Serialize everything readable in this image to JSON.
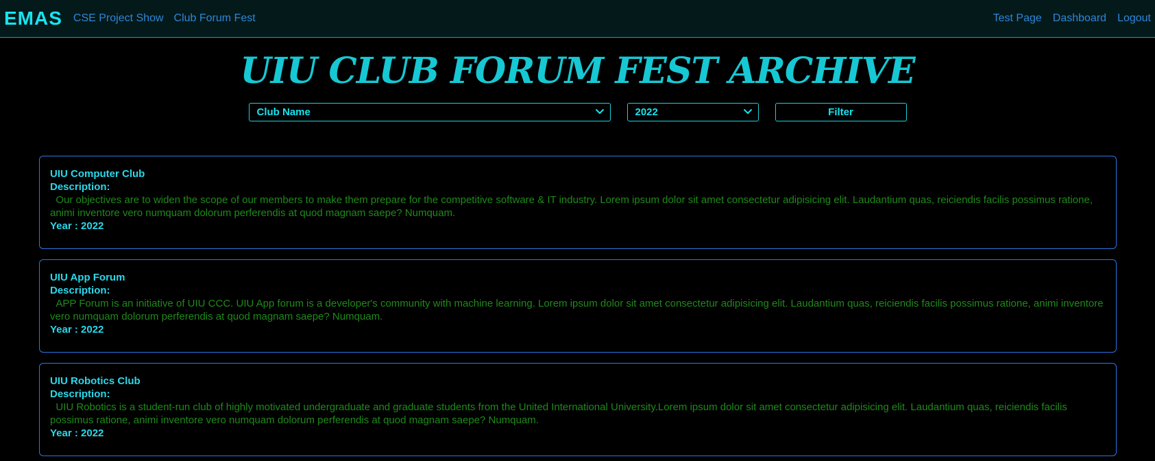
{
  "navbar": {
    "brand": "EMAS",
    "left_links": [
      "CSE Project Show",
      "Club Forum Fest"
    ],
    "right_links": [
      "Test Page",
      "Dashboard",
      "Logout"
    ]
  },
  "page_title": "UIU CLUB FORUM FEST ARCHIVE",
  "filters": {
    "club_select_value": "Club Name",
    "year_select_value": "2022",
    "filter_button_label": "Filter"
  },
  "description_label": "Description:",
  "clubs": [
    {
      "name": "UIU Computer Club",
      "description": "  Our objectives are to widen the scope of our members to make them prepare for the competitive software & IT industry. Lorem ipsum dolor sit amet consectetur adipisicing elit. Laudantium quas, reiciendis facilis possimus ratione, animi inventore vero numquam dolorum perferendis at quod magnam saepe? Numquam.",
      "year": "Year : 2022"
    },
    {
      "name": "UIU App Forum",
      "description": "  APP Forum is an initiative of UIU CCC. UIU App forum is a developer's community with machine learning. Lorem ipsum dolor sit amet consectetur adipisicing elit. Laudantium quas, reiciendis facilis possimus ratione, animi inventore vero numquam dolorum perferendis at quod magnam saepe? Numquam.",
      "year": "Year : 2022"
    },
    {
      "name": "UIU Robotics Club",
      "description": "  UIU Robotics is a student-run club of highly motivated undergraduate and graduate students from the United International University.Lorem ipsum dolor sit amet consectetur adipisicing elit. Laudantium quas, reiciendis facilis possimus ratione, animi inventore vero numquam dolorum perferendis at quod magnam saepe? Numquam.",
      "year": "Year : 2022"
    }
  ],
  "colors": {
    "accent": "#17e4f0",
    "nav_link": "#2f86d9",
    "card_border": "#2d76e6",
    "description_text": "#1f8a1a"
  },
  "icons": {
    "select_arrow": "chevron-down-icon"
  }
}
